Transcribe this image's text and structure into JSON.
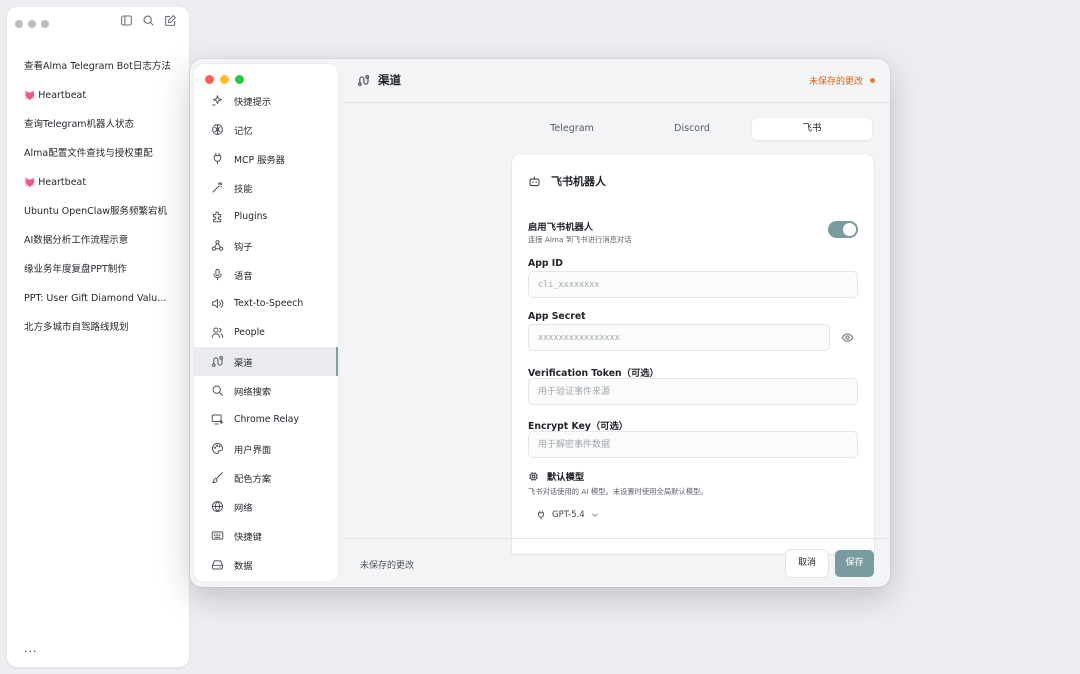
{
  "chat_window": {
    "items": [
      {
        "text": "查看Alma Telegram Bot日志方法",
        "icon": ""
      },
      {
        "text": "Heartbeat",
        "icon": "💓"
      },
      {
        "text": "查询Telegram机器人状态",
        "icon": ""
      },
      {
        "text": "Alma配置文件查找与授权重配",
        "icon": ""
      },
      {
        "text": "Heartbeat",
        "icon": "💓"
      },
      {
        "text": "Ubuntu OpenClaw服务频繁宕机",
        "icon": ""
      },
      {
        "text": "AI数据分析工作流程示意",
        "icon": ""
      },
      {
        "text": "缘业务年度复盘PPT制作",
        "icon": ""
      },
      {
        "text": "PPT: User Gift Diamond Valu...",
        "icon": ""
      },
      {
        "text": "北方多城市自驾路线规划",
        "icon": ""
      }
    ],
    "more": "..."
  },
  "sidebar": {
    "items": [
      {
        "label": "快捷提示",
        "icon": "sparkle-icon"
      },
      {
        "label": "记忆",
        "icon": "brain-icon"
      },
      {
        "label": "MCP 服务器",
        "icon": "plug-icon"
      },
      {
        "label": "技能",
        "icon": "wand-icon"
      },
      {
        "label": "Plugins",
        "icon": "puzzle-icon"
      },
      {
        "label": "钩子",
        "icon": "webhook-icon"
      },
      {
        "label": "语音",
        "icon": "mic-icon"
      },
      {
        "label": "Text-to-Speech",
        "icon": "speaker-icon"
      },
      {
        "label": "People",
        "icon": "people-icon"
      },
      {
        "label": "渠道",
        "icon": "route-icon"
      },
      {
        "label": "网络搜索",
        "icon": "search-icon"
      },
      {
        "label": "Chrome Relay",
        "icon": "monitor-icon"
      },
      {
        "label": "用户界面",
        "icon": "palette-icon"
      },
      {
        "label": "配色方案",
        "icon": "brush-icon"
      },
      {
        "label": "网络",
        "icon": "globe-icon"
      },
      {
        "label": "快捷键",
        "icon": "keyboard-icon"
      },
      {
        "label": "数据",
        "icon": "drive-icon"
      }
    ],
    "active_index": 9
  },
  "header": {
    "title": "渠道",
    "unsaved": "未保存的更改"
  },
  "tabs": [
    {
      "label": "Telegram"
    },
    {
      "label": "Discord"
    },
    {
      "label": "飞书"
    }
  ],
  "active_tab": 2,
  "card": {
    "title": "飞书机器人",
    "enable": {
      "label": "启用飞书机器人",
      "sub": "连接 Alma 到飞书进行消息对话",
      "on": true
    },
    "app_id": {
      "label": "App ID",
      "value": "",
      "placeholder": "cli_xxxxxxxx"
    },
    "app_secret": {
      "label": "App Secret",
      "value": "",
      "placeholder": "xxxxxxxxxxxxxxxx"
    },
    "verification_token": {
      "label": "Verification Token（可选）",
      "value": "",
      "placeholder": "用于验证事件来源"
    },
    "encrypt_key": {
      "label": "Encrypt Key（可选）",
      "value": "",
      "placeholder": "用于解密事件数据"
    },
    "model": {
      "label": "默认模型",
      "sub": "飞书对话使用的 AI 模型。未设置时使用全局默认模型。",
      "selected": "GPT-5.4"
    }
  },
  "footer": {
    "status": "未保存的更改",
    "cancel": "取消",
    "save": "保存"
  },
  "colors": {
    "accent": "#7a9b9f",
    "unsaved": "#e0620d"
  }
}
